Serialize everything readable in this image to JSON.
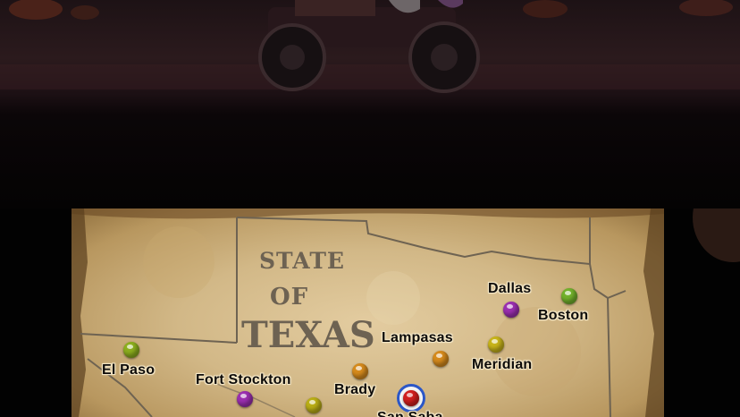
{
  "map": {
    "state_title": {
      "line1": "STATE",
      "line2": "OF",
      "line3": "TEXAS"
    },
    "towns": [
      {
        "id": "el-paso",
        "label": "El Paso",
        "marker_color": "#8cae1e"
      },
      {
        "id": "fort-stockton",
        "label": "Fort Stockton",
        "marker_color": "#9b2fb0"
      },
      {
        "id": "brady",
        "label": "Brady",
        "marker_color": "#d58a1c"
      },
      {
        "id": "lampasas",
        "label": "Lampasas",
        "marker_color": "#d58a1c"
      },
      {
        "id": "dallas",
        "label": "Dallas",
        "marker_color": "#9b2fb0"
      },
      {
        "id": "boston",
        "label": "Boston",
        "marker_color": "#72b12c"
      },
      {
        "id": "meridian",
        "label": "Meridian",
        "marker_color": "#c7b31a"
      },
      {
        "id": "san-saba",
        "label": "San Saba",
        "marker_color": "#d11f1f",
        "current": true
      },
      {
        "id": "unlabeled-west",
        "label": "",
        "marker_color": "#b9ad16"
      }
    ]
  },
  "colors": {
    "parchment": "#d8be8e",
    "border_ink": "#6e6352",
    "current_ring": "#2b57c7"
  }
}
